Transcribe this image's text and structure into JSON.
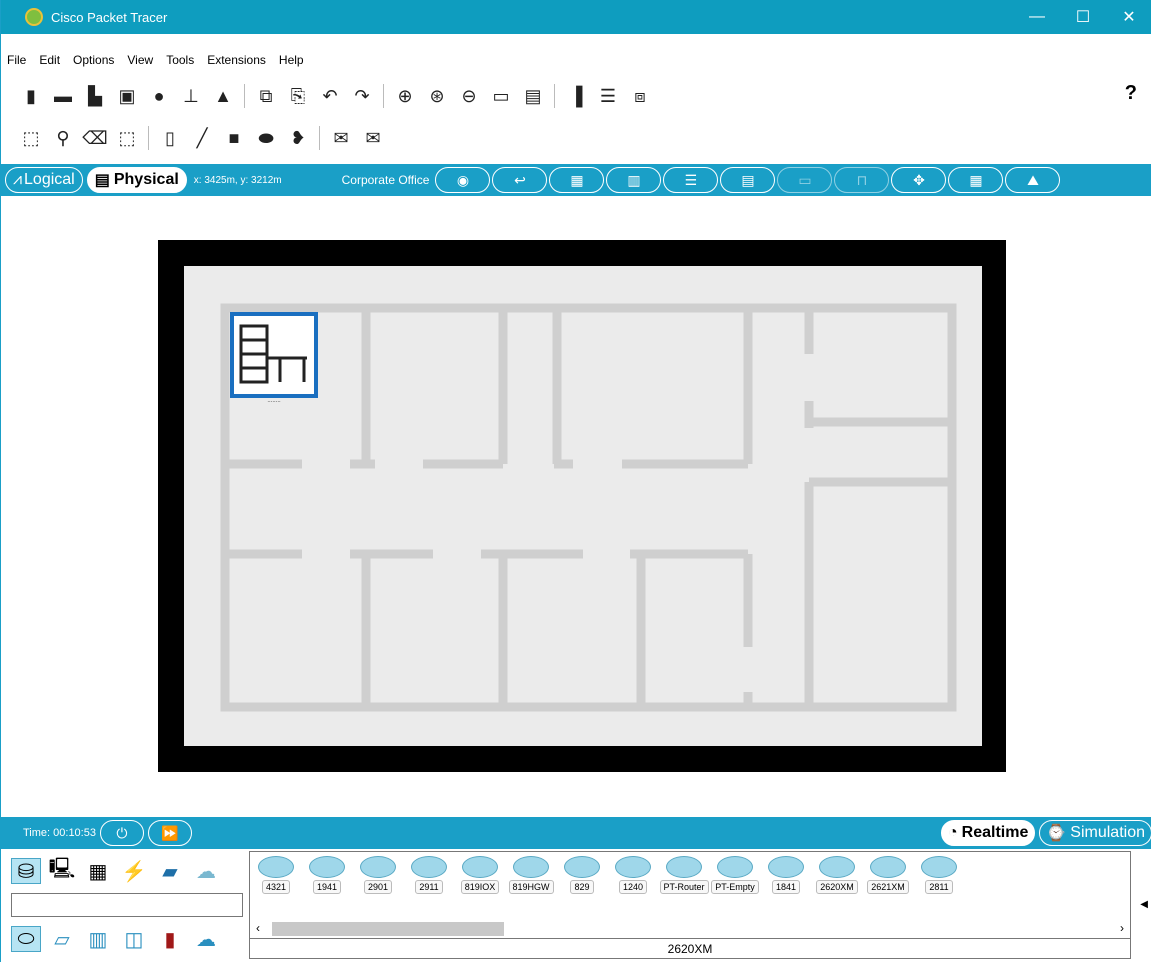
{
  "window": {
    "title": "Cisco Packet Tracer",
    "min": "—",
    "max": "☐",
    "close": "✕"
  },
  "menu": [
    "File",
    "Edit",
    "Options",
    "View",
    "Tools",
    "Extensions",
    "Help"
  ],
  "toolbar": {
    "help": "?"
  },
  "physical_bar": {
    "logical_label": "Logical",
    "physical_label": "Physical",
    "coords": "x: 3425m, y: 3212m",
    "location": "Corporate Office"
  },
  "canvas": {
    "device_caption": "........"
  },
  "status_bar": {
    "time": "Time: 00:10:53",
    "realtime_label": "Realtime",
    "simulation_label": "Simulation"
  },
  "device_panel": {
    "devices": [
      "4321",
      "1941",
      "2901",
      "2911",
      "819IOX",
      "819HGW",
      "829",
      "1240",
      "PT-Router",
      "PT-Empty",
      "1841",
      "2620XM",
      "2621XM",
      "2811"
    ],
    "selected_device": "2620XM"
  },
  "colors": {
    "accent": "#1a9fc7",
    "titlebar": "#0e9dbf",
    "wall": "#cfcfcf"
  }
}
